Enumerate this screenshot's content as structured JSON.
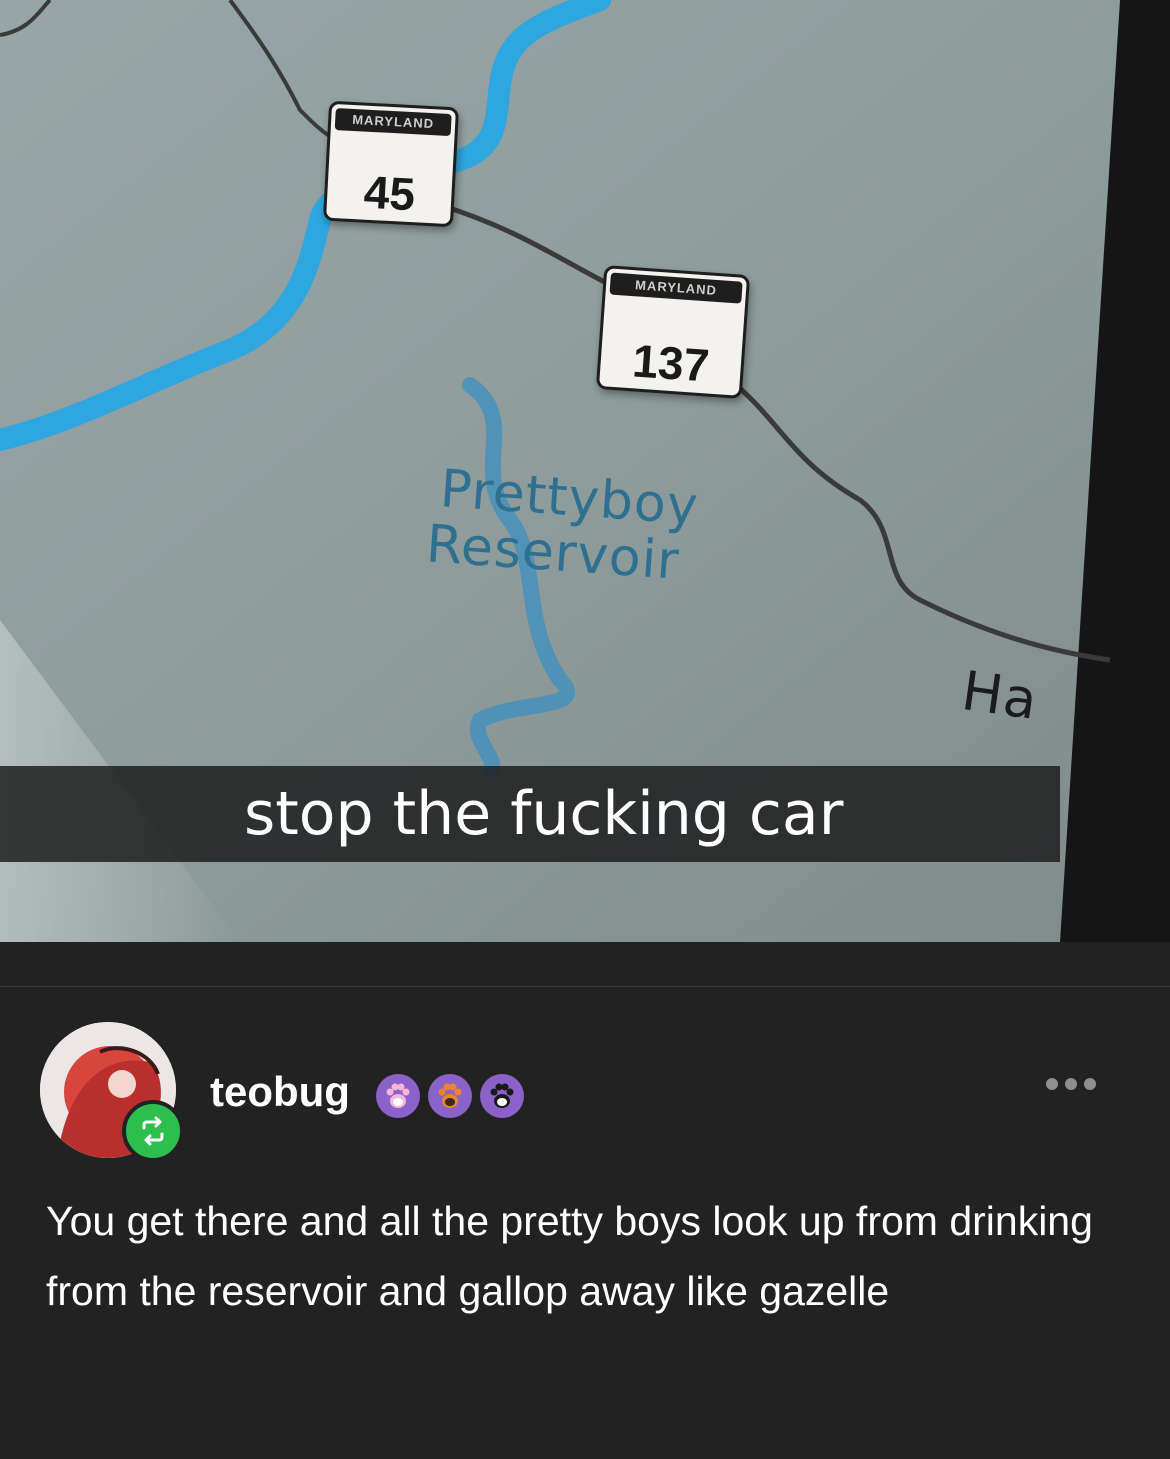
{
  "image": {
    "shield_1_state": "MARYLAND",
    "shield_1_number": "45",
    "shield_2_state": "MARYLAND",
    "shield_2_number": "137",
    "place_label": "Prettyboy\nReservoir",
    "place_label_line1": "Prettyboy",
    "place_label_line2": "Reservoir",
    "town_label": "Ha",
    "caption": "stop the fucking car"
  },
  "post": {
    "username": "teobug",
    "text": "You get there and all the pretty boys look up from drinking from the reservoir and gallop away like gazelle"
  },
  "icons": {
    "avatar": "avatar",
    "reblog": "reblog-icon",
    "badges": [
      "paw-badge-pink",
      "paw-badge-orange",
      "paw-badge-black"
    ],
    "more": "more-options-icon"
  },
  "colors": {
    "background": "#222222",
    "reblog_green": "#2dbe4e",
    "badge_purple": "#8b62c9",
    "river_blue": "#2fa6df"
  }
}
